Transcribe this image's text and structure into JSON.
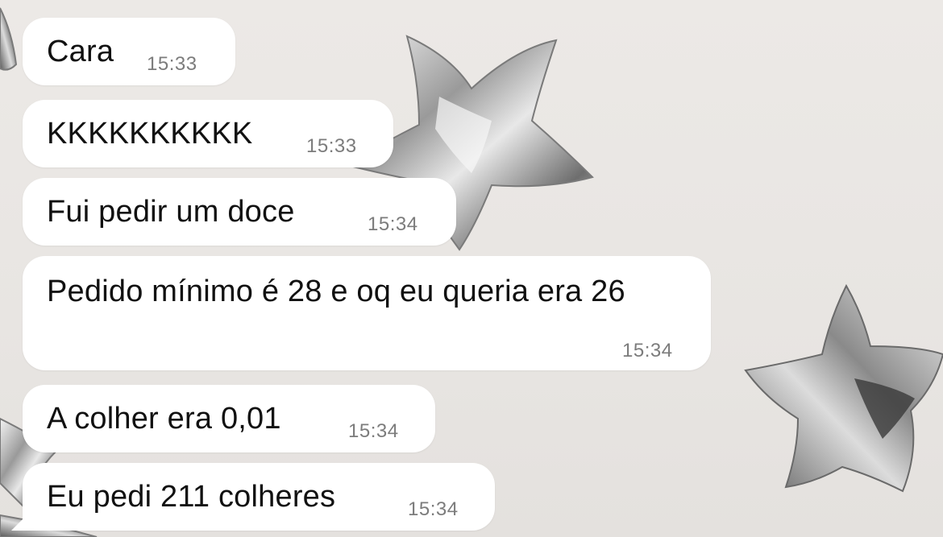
{
  "messages": [
    {
      "text": "Cara",
      "time": "15:33"
    },
    {
      "text": "KKKKKKKKKK",
      "time": "15:33"
    },
    {
      "text": "Fui pedir um doce",
      "time": "15:34"
    },
    {
      "text": "Pedido mínimo é 28 e oq eu queria era 26",
      "time": "15:34"
    },
    {
      "text": "A colher era 0,01",
      "time": "15:34"
    },
    {
      "text": "Eu pedi 211 colheres",
      "time": "15:34"
    }
  ],
  "colors": {
    "bubble": "#ffffff",
    "background": "#e9e6e3",
    "text": "#111111",
    "timestamp": "#7c7c7c",
    "wallpaper_star": "#a9a9a9"
  },
  "wallpaper": {
    "icon": "chrome-star-icon"
  }
}
